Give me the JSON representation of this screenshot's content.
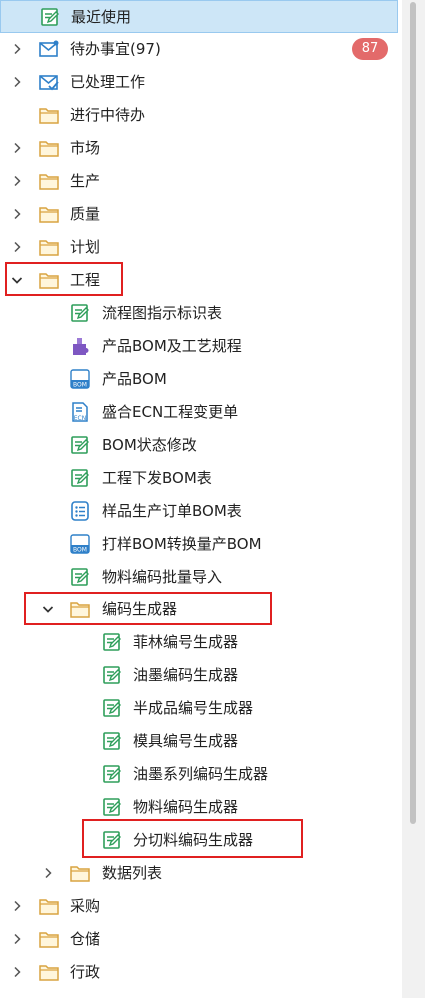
{
  "colors": {
    "selected_bg": "#cde6f7",
    "badge": "#e36a6a",
    "highlight": "#e02020",
    "folder": "#d9a441",
    "doc": "#2e9e5a",
    "mail": "#2f80c9"
  },
  "tree": {
    "recent": "最近使用",
    "todo": "待办事宜(97)",
    "todo_badge": "87",
    "processed": "已处理工作",
    "in_progress": "进行中待办",
    "market": "市场",
    "production": "生产",
    "quality": "质量",
    "plan": "计划",
    "engineering": "工程",
    "eng_items": [
      "流程图指示标识表",
      "产品BOM及工艺规程",
      "产品BOM",
      "盛合ECN工程变更单",
      "BOM状态修改",
      "工程下发BOM表",
      "样品生产订单BOM表",
      "打样BOM转换量产BOM",
      "物料编码批量导入"
    ],
    "code_gen": "编码生成器",
    "gen_items": [
      "菲林编号生成器",
      "油墨编码生成器",
      "半成品编号生成器",
      "模具编号生成器",
      "油墨系列编码生成器",
      "物料编码生成器",
      "分切料编码生成器"
    ],
    "data_list": "数据列表",
    "purchase": "采购",
    "storage": "仓储",
    "admin": "行政"
  }
}
